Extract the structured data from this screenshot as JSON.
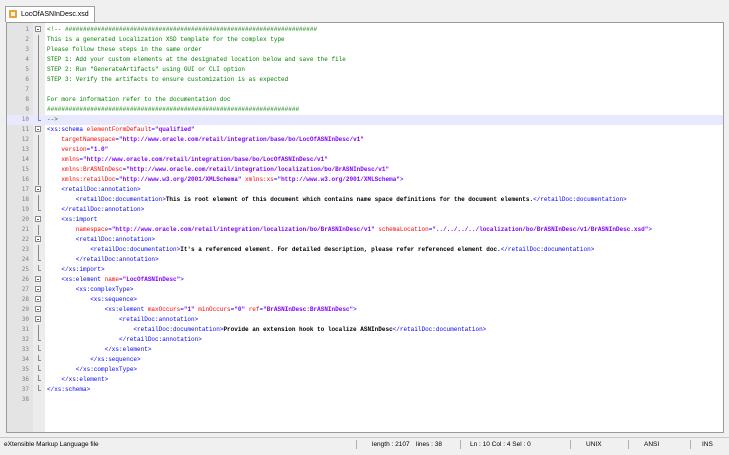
{
  "tab": {
    "filename": "LocOfASNInDesc.xsd"
  },
  "editor": {
    "current_line": 10,
    "lines": [
      {
        "n": "1",
        "fold": "box",
        "segs": [
          {
            "c": "c-comment",
            "t": "<!-- ######################################################################"
          }
        ]
      },
      {
        "n": "2",
        "fold": "vline",
        "segs": [
          {
            "c": "c-comment",
            "t": "This is a generated Localization XSD template for the complex type"
          }
        ]
      },
      {
        "n": "3",
        "fold": "vline",
        "segs": [
          {
            "c": "c-comment",
            "t": "Please follow these steps in the same order"
          }
        ]
      },
      {
        "n": "4",
        "fold": "vline",
        "segs": [
          {
            "c": "c-comment",
            "t": "STEP 1: Add your custom elements at the designated location below and save the file"
          }
        ]
      },
      {
        "n": "5",
        "fold": "vline",
        "segs": [
          {
            "c": "c-comment",
            "t": "STEP 2: Run \"GenerateArtifacts\" using GUI or CLI option"
          }
        ]
      },
      {
        "n": "6",
        "fold": "vline",
        "segs": [
          {
            "c": "c-comment",
            "t": "STEP 3: Verify the artifacts to ensure customization is as expected"
          }
        ]
      },
      {
        "n": "7",
        "fold": "vline",
        "segs": [
          {
            "c": "c-comment",
            "t": ""
          }
        ]
      },
      {
        "n": "8",
        "fold": "vline",
        "segs": [
          {
            "c": "c-comment",
            "t": "For more information refer to the documentation doc"
          }
        ]
      },
      {
        "n": "9",
        "fold": "vline",
        "segs": [
          {
            "c": "c-comment",
            "t": "######################################################################"
          }
        ]
      },
      {
        "n": "10",
        "fold": "end",
        "segs": [
          {
            "c": "c-comment",
            "t": "-->"
          }
        ]
      },
      {
        "n": "11",
        "fold": "box",
        "segs": [
          {
            "c": "c-tag",
            "t": "<xs:schema "
          },
          {
            "c": "c-attr",
            "t": "elementFormDefault"
          },
          {
            "c": "c-tag",
            "t": "="
          },
          {
            "c": "c-val",
            "t": "\"qualified\""
          }
        ]
      },
      {
        "n": "12",
        "fold": "vline",
        "segs": [
          {
            "c": "c-attr",
            "t": "    targetNamespace"
          },
          {
            "c": "c-tag",
            "t": "="
          },
          {
            "c": "c-val",
            "t": "\"http://www.oracle.com/retail/integration/base/bo/LocOfASNInDesc/v1\""
          }
        ]
      },
      {
        "n": "13",
        "fold": "vline",
        "segs": [
          {
            "c": "c-attr",
            "t": "    version"
          },
          {
            "c": "c-tag",
            "t": "="
          },
          {
            "c": "c-val",
            "t": "\"1.0\""
          }
        ]
      },
      {
        "n": "14",
        "fold": "vline",
        "segs": [
          {
            "c": "c-attr",
            "t": "    xmlns"
          },
          {
            "c": "c-tag",
            "t": "="
          },
          {
            "c": "c-val",
            "t": "\"http://www.oracle.com/retail/integration/base/bo/LocOfASNInDesc/v1\""
          }
        ]
      },
      {
        "n": "15",
        "fold": "vline",
        "segs": [
          {
            "c": "c-attr",
            "t": "    xmlns:BrASNInDesc"
          },
          {
            "c": "c-tag",
            "t": "="
          },
          {
            "c": "c-val",
            "t": "\"http://www.oracle.com/retail/integration/localization/bo/BrASNInDesc/v1\""
          }
        ]
      },
      {
        "n": "16",
        "fold": "vline",
        "segs": [
          {
            "c": "c-attr",
            "t": "    xmlns:retailDoc"
          },
          {
            "c": "c-tag",
            "t": "="
          },
          {
            "c": "c-val",
            "t": "\"http://www.w3.org/2001/XMLSchema\""
          },
          {
            "c": "c-attr",
            "t": " xmlns:xs"
          },
          {
            "c": "c-tag",
            "t": "="
          },
          {
            "c": "c-val",
            "t": "\"http://www.w3.org/2001/XMLSchema\""
          },
          {
            "c": "c-tag",
            "t": ">"
          }
        ]
      },
      {
        "n": "17",
        "fold": "box",
        "segs": [
          {
            "c": "c-tag",
            "t": "    <retailDoc:annotation>"
          }
        ]
      },
      {
        "n": "18",
        "fold": "vline",
        "segs": [
          {
            "c": "c-tag",
            "t": "        <retailDoc:documentation>"
          },
          {
            "c": "c-text",
            "t": "This is root element of this document which contains name space definitions for the document elements."
          },
          {
            "c": "c-tag",
            "t": "</retailDoc:documentation>"
          }
        ]
      },
      {
        "n": "19",
        "fold": "end",
        "segs": [
          {
            "c": "c-tag",
            "t": "    </retailDoc:annotation>"
          }
        ]
      },
      {
        "n": "20",
        "fold": "box",
        "segs": [
          {
            "c": "c-tag",
            "t": "    <xs:import"
          }
        ]
      },
      {
        "n": "21",
        "fold": "vline",
        "segs": [
          {
            "c": "c-attr",
            "t": "        namespace"
          },
          {
            "c": "c-tag",
            "t": "="
          },
          {
            "c": "c-val",
            "t": "\"http://www.oracle.com/retail/integration/localization/bo/BrASNInDesc/v1\""
          },
          {
            "c": "c-attr",
            "t": " schemaLocation"
          },
          {
            "c": "c-tag",
            "t": "="
          },
          {
            "c": "c-val",
            "t": "\"../../../../localization/bo/BrASNInDesc/v1/BrASNInDesc.xsd\""
          },
          {
            "c": "c-tag",
            "t": ">"
          }
        ]
      },
      {
        "n": "22",
        "fold": "box",
        "segs": [
          {
            "c": "c-tag",
            "t": "        <retailDoc:annotation>"
          }
        ]
      },
      {
        "n": "23",
        "fold": "vline",
        "segs": [
          {
            "c": "c-tag",
            "t": "            <retailDoc:documentation>"
          },
          {
            "c": "c-text",
            "t": "It's a referenced element. For detailed description, please refer referenced element doc."
          },
          {
            "c": "c-tag",
            "t": "</retailDoc:documentation>"
          }
        ]
      },
      {
        "n": "24",
        "fold": "end",
        "segs": [
          {
            "c": "c-tag",
            "t": "        </retailDoc:annotation>"
          }
        ]
      },
      {
        "n": "25",
        "fold": "end",
        "segs": [
          {
            "c": "c-tag",
            "t": "    </xs:import>"
          }
        ]
      },
      {
        "n": "26",
        "fold": "box",
        "segs": [
          {
            "c": "c-tag",
            "t": "    <xs:element "
          },
          {
            "c": "c-attr",
            "t": "name"
          },
          {
            "c": "c-tag",
            "t": "="
          },
          {
            "c": "c-val",
            "t": "\"LocOfASNInDesc\""
          },
          {
            "c": "c-tag",
            "t": ">"
          }
        ]
      },
      {
        "n": "27",
        "fold": "box",
        "segs": [
          {
            "c": "c-tag",
            "t": "        <xs:complexType>"
          }
        ]
      },
      {
        "n": "28",
        "fold": "box",
        "segs": [
          {
            "c": "c-tag",
            "t": "            <xs:sequence>"
          }
        ]
      },
      {
        "n": "29",
        "fold": "box",
        "segs": [
          {
            "c": "c-tag",
            "t": "                <xs:element "
          },
          {
            "c": "c-attr",
            "t": "maxOccurs"
          },
          {
            "c": "c-tag",
            "t": "="
          },
          {
            "c": "c-val",
            "t": "\"1\""
          },
          {
            "c": "c-attr",
            "t": " minOccurs"
          },
          {
            "c": "c-tag",
            "t": "="
          },
          {
            "c": "c-val",
            "t": "\"0\""
          },
          {
            "c": "c-attr",
            "t": " ref"
          },
          {
            "c": "c-tag",
            "t": "="
          },
          {
            "c": "c-val",
            "t": "\"BrASNInDesc:BrASNInDesc\""
          },
          {
            "c": "c-tag",
            "t": ">"
          }
        ]
      },
      {
        "n": "30",
        "fold": "box",
        "segs": [
          {
            "c": "c-tag",
            "t": "                    <retailDoc:annotation>"
          }
        ]
      },
      {
        "n": "31",
        "fold": "vline",
        "segs": [
          {
            "c": "c-tag",
            "t": "                        <retailDoc:documentation>"
          },
          {
            "c": "c-text",
            "t": "Provide an extension hook to localize ASNInDesc"
          },
          {
            "c": "c-tag",
            "t": "</retailDoc:documentation>"
          }
        ]
      },
      {
        "n": "32",
        "fold": "end",
        "segs": [
          {
            "c": "c-tag",
            "t": "                    </retailDoc:annotation>"
          }
        ]
      },
      {
        "n": "33",
        "fold": "end",
        "segs": [
          {
            "c": "c-tag",
            "t": "                </xs:element>"
          }
        ]
      },
      {
        "n": "34",
        "fold": "end",
        "segs": [
          {
            "c": "c-tag",
            "t": "            </xs:sequence>"
          }
        ]
      },
      {
        "n": "35",
        "fold": "end",
        "segs": [
          {
            "c": "c-tag",
            "t": "        </xs:complexType>"
          }
        ]
      },
      {
        "n": "36",
        "fold": "end",
        "segs": [
          {
            "c": "c-tag",
            "t": "    </xs:element>"
          }
        ]
      },
      {
        "n": "37",
        "fold": "end",
        "segs": [
          {
            "c": "c-tag",
            "t": "</xs:schema>"
          }
        ]
      },
      {
        "n": "38",
        "fold": "",
        "segs": []
      }
    ]
  },
  "status": {
    "file_type": "eXtensible Markup Language file",
    "length": "length : 2107",
    "lines": "lines : 38",
    "position": "Ln : 10   Col : 4   Sel : 0",
    "eol": "UNIX",
    "encoding": "ANSI",
    "mode": "INS"
  }
}
